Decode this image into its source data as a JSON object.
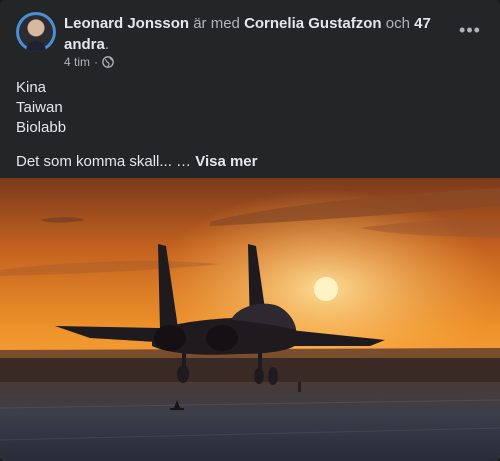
{
  "post": {
    "author": "Leonard Jonsson",
    "with_text": "är med",
    "tagged": "Cornelia Gustafzon",
    "and_text": "och",
    "others": "47 andra",
    "period": ".",
    "time": "4 tim",
    "meta_sep": "·",
    "privacy_icon": "globe-icon",
    "menu_icon": "more-options-icon",
    "menu_glyph": "•••",
    "lines": [
      "Kina",
      "Taiwan",
      "Biolabb"
    ],
    "caption": "Det som komma skall... …",
    "see_more": "Visa mer",
    "image_subject": "fighter-jet-at-sunset"
  },
  "colors": {
    "card": "#242526",
    "text_primary": "#e4e6eb",
    "text_secondary": "#b0b3b8",
    "sky_top": "#7a3a1c",
    "sun": "#fff3c4"
  }
}
